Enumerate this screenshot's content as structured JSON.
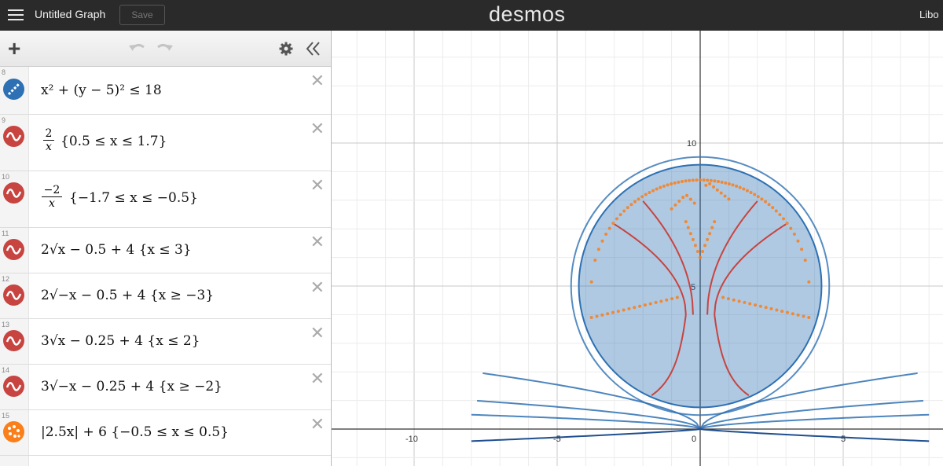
{
  "app": {
    "title": "Untitled Graph",
    "save_label": "Save",
    "brand": "desmos",
    "user_name": "Libo"
  },
  "toolbar": {
    "add_icon": "plus-icon",
    "undo_icon": "undo-icon",
    "redo_icon": "redo-icon",
    "settings_icon": "gear-icon",
    "collapse_icon": "double-chevron-left-icon"
  },
  "expressions": [
    {
      "num": "8",
      "color": "#2d70b3",
      "icon": "inequality-region-icon",
      "latex": "x² + (y − 5)² ≤ 18"
    },
    {
      "num": "9",
      "color": "#c74440",
      "icon": "function-wave-icon",
      "frac_num": "2",
      "frac_den": "x",
      "latex": "{0.5 ≤ x ≤ 1.7}"
    },
    {
      "num": "10",
      "color": "#c74440",
      "icon": "function-wave-icon",
      "frac_num": "−2",
      "frac_den": "x",
      "latex": "{−1.7 ≤ x ≤ −0.5}"
    },
    {
      "num": "11",
      "color": "#c74440",
      "icon": "function-wave-icon",
      "latex": "2√x − 0.5 + 4 {x ≤ 3}"
    },
    {
      "num": "12",
      "color": "#c74440",
      "icon": "function-wave-icon",
      "latex": "2√−x − 0.5 + 4 {x ≥ −3}"
    },
    {
      "num": "13",
      "color": "#c74440",
      "icon": "function-wave-icon",
      "latex": "3√x − 0.25 + 4 {x ≤ 2}"
    },
    {
      "num": "14",
      "color": "#c74440",
      "icon": "function-wave-icon",
      "latex": "3√−x − 0.25 + 4 {x ≥ −2}"
    },
    {
      "num": "15",
      "color": "#fa7e19",
      "icon": "dotted-points-icon",
      "latex": "|2.5x| + 6 {−0.5 ≤ x ≤ 0.5}"
    }
  ],
  "graph": {
    "x_tick_labels": [
      "-10",
      "-5",
      "0",
      "5"
    ],
    "y_tick_labels": [
      "5",
      "10"
    ],
    "colors": {
      "blue": "#2d70b3",
      "red": "#c74440",
      "orange": "#fa7e19",
      "dark_blue": "#1f4f8f"
    }
  }
}
